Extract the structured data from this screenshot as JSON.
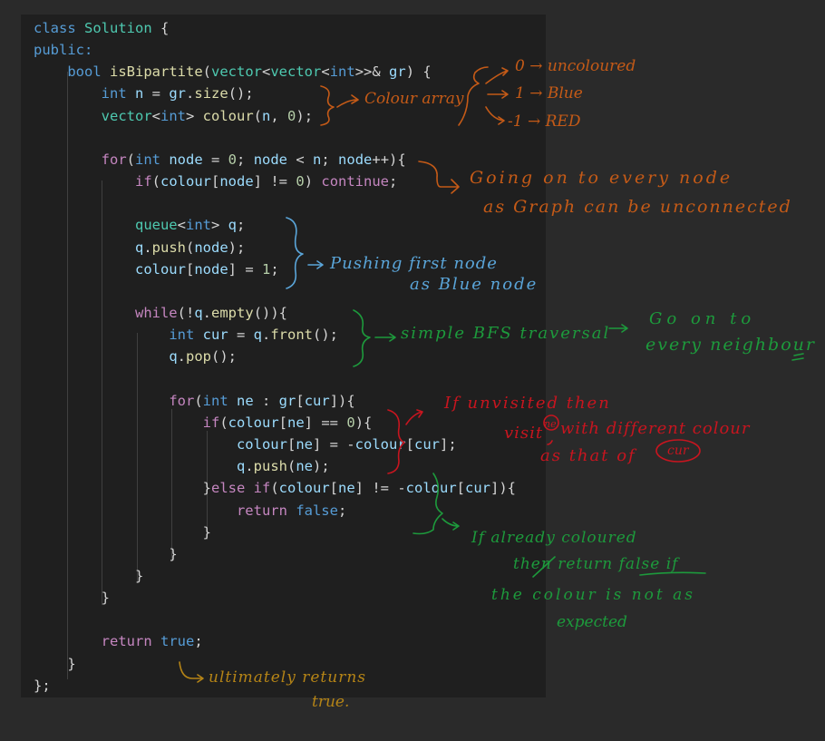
{
  "code_lines": [
    {
      "tokens": [
        {
          "t": "class ",
          "c": "#569cd6"
        },
        {
          "t": "Solution",
          "c": "#4ec9b0"
        },
        {
          "t": " {",
          "c": "#d4d4d4"
        }
      ]
    },
    {
      "tokens": [
        {
          "t": "public:",
          "c": "#569cd6"
        }
      ]
    },
    {
      "tokens": [
        {
          "t": "    ",
          "c": "#d4d4d4"
        },
        {
          "t": "bool",
          "c": "#569cd6"
        },
        {
          "t": " ",
          "c": "#d4d4d4"
        },
        {
          "t": "isBipartite",
          "c": "#dcdcaa"
        },
        {
          "t": "(",
          "c": "#d4d4d4"
        },
        {
          "t": "vector",
          "c": "#4ec9b0"
        },
        {
          "t": "<",
          "c": "#d4d4d4"
        },
        {
          "t": "vector",
          "c": "#4ec9b0"
        },
        {
          "t": "<",
          "c": "#d4d4d4"
        },
        {
          "t": "int",
          "c": "#569cd6"
        },
        {
          "t": ">>& ",
          "c": "#d4d4d4"
        },
        {
          "t": "gr",
          "c": "#9cdcfe"
        },
        {
          "t": ") {",
          "c": "#d4d4d4"
        }
      ]
    },
    {
      "tokens": [
        {
          "t": "        ",
          "c": "#d4d4d4"
        },
        {
          "t": "int",
          "c": "#569cd6"
        },
        {
          "t": " ",
          "c": "#d4d4d4"
        },
        {
          "t": "n",
          "c": "#9cdcfe"
        },
        {
          "t": " = ",
          "c": "#d4d4d4"
        },
        {
          "t": "gr",
          "c": "#9cdcfe"
        },
        {
          "t": ".",
          "c": "#d4d4d4"
        },
        {
          "t": "size",
          "c": "#dcdcaa"
        },
        {
          "t": "();",
          "c": "#d4d4d4"
        }
      ]
    },
    {
      "tokens": [
        {
          "t": "        ",
          "c": "#d4d4d4"
        },
        {
          "t": "vector",
          "c": "#4ec9b0"
        },
        {
          "t": "<",
          "c": "#d4d4d4"
        },
        {
          "t": "int",
          "c": "#569cd6"
        },
        {
          "t": "> ",
          "c": "#d4d4d4"
        },
        {
          "t": "colour",
          "c": "#dcdcaa"
        },
        {
          "t": "(",
          "c": "#d4d4d4"
        },
        {
          "t": "n",
          "c": "#9cdcfe"
        },
        {
          "t": ", ",
          "c": "#d4d4d4"
        },
        {
          "t": "0",
          "c": "#b5cea8"
        },
        {
          "t": ");",
          "c": "#d4d4d4"
        }
      ]
    },
    {
      "tokens": []
    },
    {
      "tokens": [
        {
          "t": "        ",
          "c": "#d4d4d4"
        },
        {
          "t": "for",
          "c": "#c586c0"
        },
        {
          "t": "(",
          "c": "#d4d4d4"
        },
        {
          "t": "int",
          "c": "#569cd6"
        },
        {
          "t": " ",
          "c": "#d4d4d4"
        },
        {
          "t": "node",
          "c": "#9cdcfe"
        },
        {
          "t": " = ",
          "c": "#d4d4d4"
        },
        {
          "t": "0",
          "c": "#b5cea8"
        },
        {
          "t": "; ",
          "c": "#d4d4d4"
        },
        {
          "t": "node",
          "c": "#9cdcfe"
        },
        {
          "t": " < ",
          "c": "#d4d4d4"
        },
        {
          "t": "n",
          "c": "#9cdcfe"
        },
        {
          "t": "; ",
          "c": "#d4d4d4"
        },
        {
          "t": "node",
          "c": "#9cdcfe"
        },
        {
          "t": "++){",
          "c": "#d4d4d4"
        }
      ]
    },
    {
      "tokens": [
        {
          "t": "            ",
          "c": "#d4d4d4"
        },
        {
          "t": "if",
          "c": "#c586c0"
        },
        {
          "t": "(",
          "c": "#d4d4d4"
        },
        {
          "t": "colour",
          "c": "#9cdcfe"
        },
        {
          "t": "[",
          "c": "#d4d4d4"
        },
        {
          "t": "node",
          "c": "#9cdcfe"
        },
        {
          "t": "] != ",
          "c": "#d4d4d4"
        },
        {
          "t": "0",
          "c": "#b5cea8"
        },
        {
          "t": ") ",
          "c": "#d4d4d4"
        },
        {
          "t": "continue",
          "c": "#c586c0"
        },
        {
          "t": ";",
          "c": "#d4d4d4"
        }
      ]
    },
    {
      "tokens": []
    },
    {
      "tokens": [
        {
          "t": "            ",
          "c": "#d4d4d4"
        },
        {
          "t": "queue",
          "c": "#4ec9b0"
        },
        {
          "t": "<",
          "c": "#d4d4d4"
        },
        {
          "t": "int",
          "c": "#569cd6"
        },
        {
          "t": "> ",
          "c": "#d4d4d4"
        },
        {
          "t": "q",
          "c": "#9cdcfe"
        },
        {
          "t": ";",
          "c": "#d4d4d4"
        }
      ]
    },
    {
      "tokens": [
        {
          "t": "            ",
          "c": "#d4d4d4"
        },
        {
          "t": "q",
          "c": "#9cdcfe"
        },
        {
          "t": ".",
          "c": "#d4d4d4"
        },
        {
          "t": "push",
          "c": "#dcdcaa"
        },
        {
          "t": "(",
          "c": "#d4d4d4"
        },
        {
          "t": "node",
          "c": "#9cdcfe"
        },
        {
          "t": ");",
          "c": "#d4d4d4"
        }
      ]
    },
    {
      "tokens": [
        {
          "t": "            ",
          "c": "#d4d4d4"
        },
        {
          "t": "colour",
          "c": "#9cdcfe"
        },
        {
          "t": "[",
          "c": "#d4d4d4"
        },
        {
          "t": "node",
          "c": "#9cdcfe"
        },
        {
          "t": "] = ",
          "c": "#d4d4d4"
        },
        {
          "t": "1",
          "c": "#b5cea8"
        },
        {
          "t": ";",
          "c": "#d4d4d4"
        }
      ]
    },
    {
      "tokens": []
    },
    {
      "tokens": [
        {
          "t": "            ",
          "c": "#d4d4d4"
        },
        {
          "t": "while",
          "c": "#c586c0"
        },
        {
          "t": "(!",
          "c": "#d4d4d4"
        },
        {
          "t": "q",
          "c": "#9cdcfe"
        },
        {
          "t": ".",
          "c": "#d4d4d4"
        },
        {
          "t": "empty",
          "c": "#dcdcaa"
        },
        {
          "t": "()){",
          "c": "#d4d4d4"
        }
      ]
    },
    {
      "tokens": [
        {
          "t": "                ",
          "c": "#d4d4d4"
        },
        {
          "t": "int",
          "c": "#569cd6"
        },
        {
          "t": " ",
          "c": "#d4d4d4"
        },
        {
          "t": "cur",
          "c": "#9cdcfe"
        },
        {
          "t": " = ",
          "c": "#d4d4d4"
        },
        {
          "t": "q",
          "c": "#9cdcfe"
        },
        {
          "t": ".",
          "c": "#d4d4d4"
        },
        {
          "t": "front",
          "c": "#dcdcaa"
        },
        {
          "t": "();",
          "c": "#d4d4d4"
        }
      ]
    },
    {
      "tokens": [
        {
          "t": "                ",
          "c": "#d4d4d4"
        },
        {
          "t": "q",
          "c": "#9cdcfe"
        },
        {
          "t": ".",
          "c": "#d4d4d4"
        },
        {
          "t": "pop",
          "c": "#dcdcaa"
        },
        {
          "t": "();",
          "c": "#d4d4d4"
        }
      ]
    },
    {
      "tokens": []
    },
    {
      "tokens": [
        {
          "t": "                ",
          "c": "#d4d4d4"
        },
        {
          "t": "for",
          "c": "#c586c0"
        },
        {
          "t": "(",
          "c": "#d4d4d4"
        },
        {
          "t": "int",
          "c": "#569cd6"
        },
        {
          "t": " ",
          "c": "#d4d4d4"
        },
        {
          "t": "ne",
          "c": "#9cdcfe"
        },
        {
          "t": " : ",
          "c": "#d4d4d4"
        },
        {
          "t": "gr",
          "c": "#9cdcfe"
        },
        {
          "t": "[",
          "c": "#d4d4d4"
        },
        {
          "t": "cur",
          "c": "#9cdcfe"
        },
        {
          "t": "]){",
          "c": "#d4d4d4"
        }
      ]
    },
    {
      "tokens": [
        {
          "t": "                    ",
          "c": "#d4d4d4"
        },
        {
          "t": "if",
          "c": "#c586c0"
        },
        {
          "t": "(",
          "c": "#d4d4d4"
        },
        {
          "t": "colour",
          "c": "#9cdcfe"
        },
        {
          "t": "[",
          "c": "#d4d4d4"
        },
        {
          "t": "ne",
          "c": "#9cdcfe"
        },
        {
          "t": "] == ",
          "c": "#d4d4d4"
        },
        {
          "t": "0",
          "c": "#b5cea8"
        },
        {
          "t": "){",
          "c": "#d4d4d4"
        }
      ]
    },
    {
      "tokens": [
        {
          "t": "                        ",
          "c": "#d4d4d4"
        },
        {
          "t": "colour",
          "c": "#9cdcfe"
        },
        {
          "t": "[",
          "c": "#d4d4d4"
        },
        {
          "t": "ne",
          "c": "#9cdcfe"
        },
        {
          "t": "] = -",
          "c": "#d4d4d4"
        },
        {
          "t": "colour",
          "c": "#9cdcfe"
        },
        {
          "t": "[",
          "c": "#d4d4d4"
        },
        {
          "t": "cur",
          "c": "#9cdcfe"
        },
        {
          "t": "];",
          "c": "#d4d4d4"
        }
      ]
    },
    {
      "tokens": [
        {
          "t": "                        ",
          "c": "#d4d4d4"
        },
        {
          "t": "q",
          "c": "#9cdcfe"
        },
        {
          "t": ".",
          "c": "#d4d4d4"
        },
        {
          "t": "push",
          "c": "#dcdcaa"
        },
        {
          "t": "(",
          "c": "#d4d4d4"
        },
        {
          "t": "ne",
          "c": "#9cdcfe"
        },
        {
          "t": ");",
          "c": "#d4d4d4"
        }
      ]
    },
    {
      "tokens": [
        {
          "t": "                    ",
          "c": "#d4d4d4"
        },
        {
          "t": "}",
          "c": "#d4d4d4"
        },
        {
          "t": "else if",
          "c": "#c586c0"
        },
        {
          "t": "(",
          "c": "#d4d4d4"
        },
        {
          "t": "colour",
          "c": "#9cdcfe"
        },
        {
          "t": "[",
          "c": "#d4d4d4"
        },
        {
          "t": "ne",
          "c": "#9cdcfe"
        },
        {
          "t": "] != -",
          "c": "#d4d4d4"
        },
        {
          "t": "colour",
          "c": "#9cdcfe"
        },
        {
          "t": "[",
          "c": "#d4d4d4"
        },
        {
          "t": "cur",
          "c": "#9cdcfe"
        },
        {
          "t": "]){",
          "c": "#d4d4d4"
        }
      ]
    },
    {
      "tokens": [
        {
          "t": "                        ",
          "c": "#d4d4d4"
        },
        {
          "t": "return",
          "c": "#c586c0"
        },
        {
          "t": " ",
          "c": "#d4d4d4"
        },
        {
          "t": "false",
          "c": "#569cd6"
        },
        {
          "t": ";",
          "c": "#d4d4d4"
        }
      ]
    },
    {
      "tokens": [
        {
          "t": "                    ",
          "c": "#d4d4d4"
        },
        {
          "t": "}",
          "c": "#d4d4d4"
        }
      ]
    },
    {
      "tokens": [
        {
          "t": "                ",
          "c": "#d4d4d4"
        },
        {
          "t": "}",
          "c": "#d4d4d4"
        }
      ]
    },
    {
      "tokens": [
        {
          "t": "            ",
          "c": "#d4d4d4"
        },
        {
          "t": "}",
          "c": "#d4d4d4"
        }
      ]
    },
    {
      "tokens": [
        {
          "t": "        ",
          "c": "#d4d4d4"
        },
        {
          "t": "}",
          "c": "#d4d4d4"
        }
      ]
    },
    {
      "tokens": []
    },
    {
      "tokens": [
        {
          "t": "        ",
          "c": "#d4d4d4"
        },
        {
          "t": "return",
          "c": "#c586c0"
        },
        {
          "t": " ",
          "c": "#d4d4d4"
        },
        {
          "t": "true",
          "c": "#569cd6"
        },
        {
          "t": ";",
          "c": "#d4d4d4"
        }
      ]
    },
    {
      "tokens": [
        {
          "t": "    ",
          "c": "#d4d4d4"
        },
        {
          "t": "}",
          "c": "#d4d4d4"
        }
      ]
    },
    {
      "tokens": [
        {
          "t": "};",
          "c": "#d4d4d4"
        }
      ]
    }
  ],
  "annotations": {
    "colour_array": "Colour array",
    "uncoloured": "0 → uncoloured",
    "blue": "1 → Blue",
    "red": "-1 → RED",
    "every_node_1": "Going on to every node",
    "every_node_2": "as Graph can be unconnected",
    "push_first_1": "Pushing first node",
    "push_first_2": "as Blue node",
    "bfs": "simple BFS traversal",
    "neighbour_1": "Go on to",
    "neighbour_2": "every neighbour",
    "unvisited_1": "If unvisited then",
    "unvisited_2": "visit",
    "unvisited_ne": "ne",
    "unvisited_3": "with different colour",
    "unvisited_4": "as that of",
    "unvisited_cur": "cur",
    "coloured_1": "If already coloured",
    "coloured_2": "then return false if",
    "coloured_3": "the colour is not as",
    "coloured_4": "expected",
    "ultimately_1": "ultimately returns",
    "ultimately_2": "true."
  },
  "colors": {
    "background": "#2a2a2a",
    "editor_background": "#1f1f1f",
    "ink_orange": "#c45a17",
    "ink_blue": "#5aa5d9",
    "ink_green": "#1d9a3c",
    "ink_red": "#c7151f",
    "ink_gold": "#b58416"
  }
}
